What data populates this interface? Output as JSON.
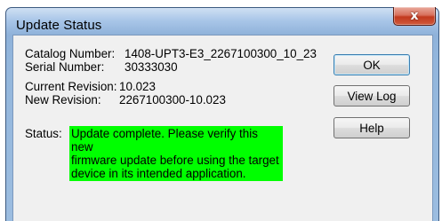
{
  "window": {
    "title": "Update Status",
    "close_glyph": "x"
  },
  "info": {
    "catalog_label": "Catalog Number:",
    "catalog_value": "1408-UPT3-E3_2267100300_10_23",
    "serial_label": "Serial Number:",
    "serial_value": "30333030",
    "current_label": "Current Revision:",
    "current_value": "10.023",
    "new_label": "New Revision:",
    "new_value": "2267100300-10.023",
    "status_label": "Status:",
    "status_lines": [
      "Update complete. Please verify this new",
      "firmware update before using the target",
      "device in its intended application."
    ]
  },
  "buttons": {
    "ok": "OK",
    "view_log": "View Log",
    "help": "Help"
  },
  "colors": {
    "status_background": "#00ff00",
    "title_bar": "#a9c6e8",
    "close_button": "#c2391e"
  },
  "icons": {
    "close": "close-icon"
  }
}
